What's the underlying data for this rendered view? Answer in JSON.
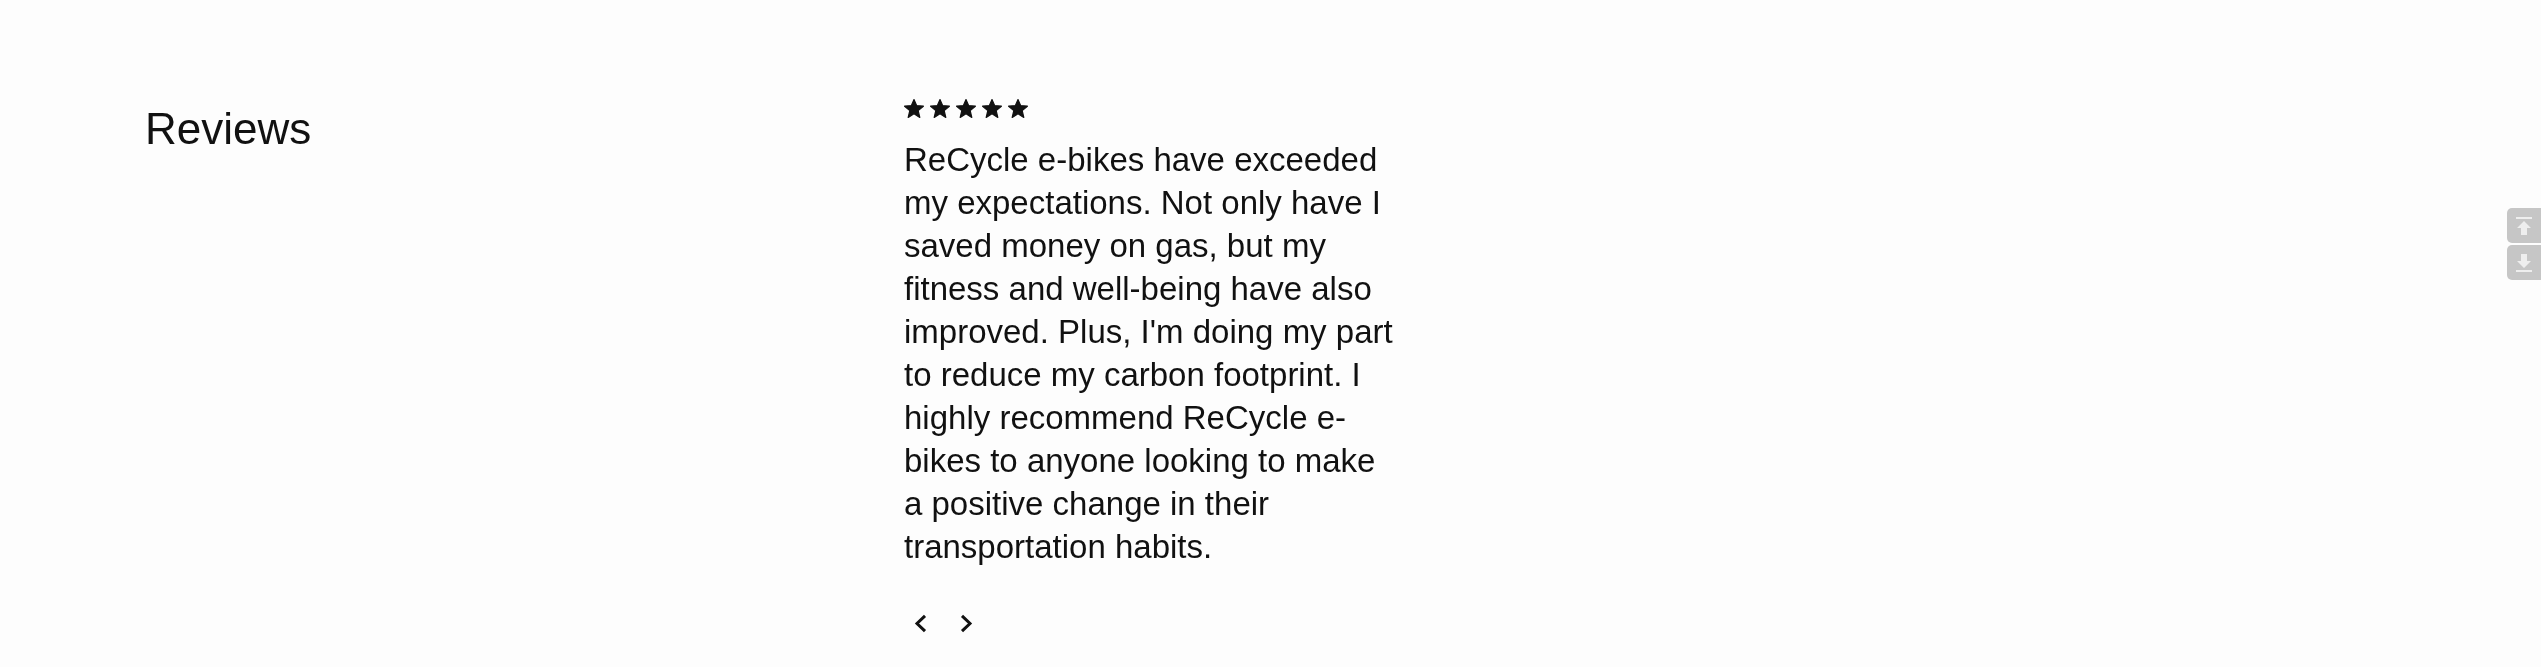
{
  "section": {
    "title": "Reviews"
  },
  "review": {
    "stars": 5,
    "text": "ReCycle e-bikes have exceeded my expectations. Not only have I saved money on gas, but my fitness and well-being have also improved. Plus, I'm doing my part to reduce my carbon footprint. I highly recommend ReCycle e-bikes to anyone looking to make a positive change in their transportation habits."
  }
}
